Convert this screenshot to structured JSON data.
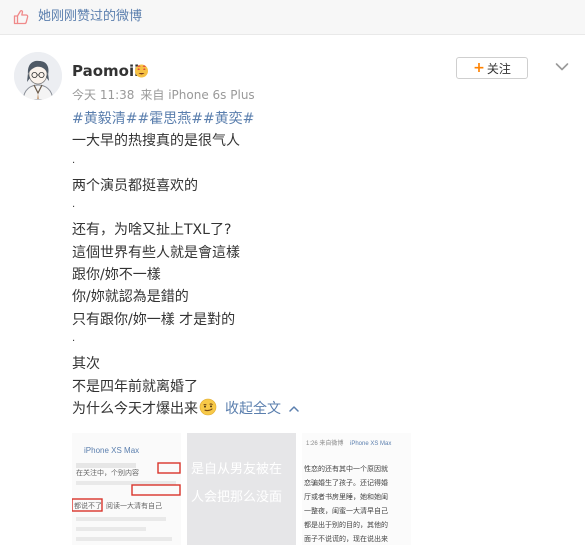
{
  "liked_header": {
    "text": "她刚刚赞过的微博",
    "icon": "thumbs-up-icon"
  },
  "post": {
    "author": {
      "name": "Paomoii",
      "badge_icon": "emoji-badge-icon"
    },
    "follow_button": {
      "plus": "+",
      "label": "关注"
    },
    "meta": {
      "time": "今天 11:38",
      "source": "来自 iPhone 6s Plus"
    },
    "hashtags": [
      "#黄毅清#",
      "#霍思燕#",
      "#黄奕#"
    ],
    "lines": [
      "一大早的热搜真的是很气人",
      "·",
      "两个演员都挺喜欢的",
      "·",
      "还有，为啥又扯上TXL了?",
      "這個世界有些人就是會這樣",
      "跟你/妳不一樣",
      "你/妳就認為是錯的",
      "只有跟你/妳一樣 才是對的",
      "·",
      "其次",
      "不是四年前就离婚了",
      "为什么今天才爆出来"
    ],
    "emoji_icon": "smirk-emoji-icon",
    "collapse_label": "收起全文",
    "thumbnails": {
      "first": {
        "header": "iPhone XS Max",
        "rows": [
          "在关注中，个别内容",
          "都说不了",
          "阅读一大清有自己"
        ]
      },
      "second": {
        "rows": [
          "是自从男友被在",
          "人会把那么没面"
        ]
      },
      "third": {
        "header": "1:26 来自微博",
        "source": "iPhone XS Max",
        "rows": [
          "性恋的还有其中一个原因就",
          "恋骗婚生了孩子。还记得婚",
          "厅或者书房里睡，她和她闺",
          "一整夜，闺蜜一大清早自己",
          "都是出于别的目的，其他的",
          "面子不说谎的，现在说出来"
        ]
      }
    },
    "colors": {
      "link": "#5b7fae",
      "accent": "#ff8200",
      "meta": "#999999",
      "text": "#333333"
    }
  }
}
